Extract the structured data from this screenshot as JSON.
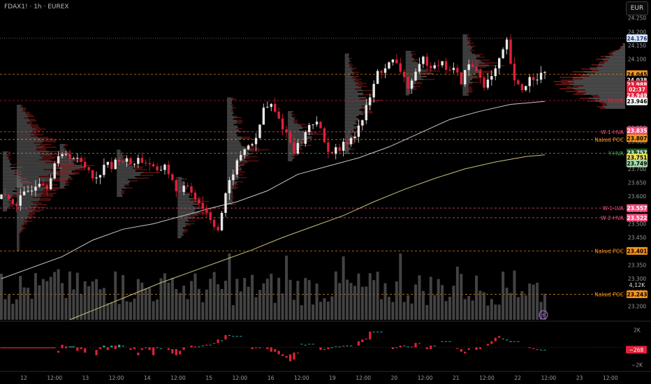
{
  "header": {
    "symbol_title": "FDAX1! · 1h · EUREX",
    "currency": "EUR"
  },
  "colors": {
    "background": "#000000",
    "up": "#e8e8e8",
    "down": "#e0213a",
    "ma_short": "#c8c8c8",
    "ma_long": "#c8c07a",
    "profile": "#8a8a8a",
    "profile_red": "#8b1a1a",
    "volume": "#5a5a5a",
    "axis_text": "#9a9a9a"
  },
  "chart_data": [
    {
      "type": "candlestick",
      "title": "FDAX1! · 1h · EUREX",
      "ylim": [
        23150,
        24290
      ],
      "y_ticks": [
        24250,
        24200,
        24150,
        24100,
        24050,
        24000,
        23950,
        23850,
        23800,
        23750,
        23700,
        23650,
        23600,
        23550,
        23500,
        23450,
        23400,
        23350,
        23300,
        23250,
        23200
      ],
      "x_ticks": [
        "12",
        "12:00",
        "13",
        "12:00",
        "14",
        "12:00",
        "15",
        "12:00",
        "16",
        "12:00",
        "19",
        "12:00",
        "20",
        "12:00",
        "21",
        "12:00",
        "22",
        "12:00",
        "23",
        "12:00"
      ],
      "price_axis_labels": [
        {
          "text": "24.176",
          "value": 24176,
          "bg": "#dde8f8",
          "fg": "#1a3a7a"
        },
        {
          "text": "24.045",
          "value": 24045,
          "bg": "#f7931a",
          "fg": "#000000"
        },
        {
          "text": "24.038",
          "value": 24024,
          "bg": "#000000",
          "fg": "#ffffff"
        },
        {
          "text": "23.988",
          "value": 24008,
          "bg": "#e0213a",
          "fg": "#ffffff"
        },
        {
          "text": "02:37",
          "value": 23990,
          "bg": "#e0213a",
          "fg": "#ffffff"
        },
        {
          "text": "23.949",
          "value": 23968,
          "bg": "#e0213a",
          "fg": "#ffffff"
        },
        {
          "text": "23.946",
          "value": 23946,
          "bg": "#ffffff",
          "fg": "#000000"
        },
        {
          "text": "23.835",
          "value": 23840,
          "bg": "#f04e7c",
          "fg": "#ffffff"
        },
        {
          "text": "23.807",
          "value": 23812,
          "bg": "#f7931a",
          "fg": "#000000"
        },
        {
          "text": "23.757",
          "value": 23760,
          "bg": "#1b5e20",
          "fg": "#ffffff"
        },
        {
          "text": "23.751",
          "value": 23741,
          "bg": "#f0e35a",
          "fg": "#000000"
        },
        {
          "text": "23.749",
          "value": 23720,
          "bg": "#a5d6a7",
          "fg": "#000000"
        },
        {
          "text": "23.557",
          "value": 23557,
          "bg": "#f04e7c",
          "fg": "#ffffff"
        },
        {
          "text": "23.522",
          "value": 23522,
          "bg": "#f04e7c",
          "fg": "#ffffff"
        },
        {
          "text": "23.401",
          "value": 23401,
          "bg": "#f7931a",
          "fg": "#000000"
        },
        {
          "text": "23.243",
          "value": 23243,
          "bg": "#f7931a",
          "fg": "#000000"
        }
      ],
      "levels": [
        {
          "label": "",
          "value": 24176,
          "color": "#7a7a7a",
          "style": "dotted"
        },
        {
          "label": "",
          "value": 24045,
          "color": "#f7931a",
          "style": "dashed"
        },
        {
          "label": "W-LVA",
          "value": 23949,
          "color": "#e0213a",
          "style": "dashed"
        },
        {
          "label": "W-1-HVA",
          "value": 23835,
          "color": "#f04e7c",
          "style": "dashed"
        },
        {
          "label": "Naked POC",
          "value": 23807,
          "color": "#f7931a",
          "style": "dashed"
        },
        {
          "label": "Y-HVA",
          "value": 23757,
          "color": "#4caf50",
          "style": "dashed"
        },
        {
          "label": "W-1-LVA",
          "value": 23557,
          "color": "#f04e7c",
          "style": "dashed"
        },
        {
          "label": "W-2-HVA",
          "value": 23522,
          "color": "#f04e7c",
          "style": "dashed"
        },
        {
          "label": "Naked POC",
          "value": 23401,
          "color": "#f7931a",
          "style": "dashed"
        },
        {
          "label": "Naked POC",
          "value": 23243,
          "color": "#f7931a",
          "style": "dashed"
        }
      ],
      "volume_label": "4,12K",
      "close_path": [
        [
          0,
          23600
        ],
        [
          4,
          23575
        ],
        [
          7,
          23620
        ],
        [
          10,
          23660
        ],
        [
          12,
          23640
        ],
        [
          14,
          23720
        ],
        [
          17,
          23760
        ],
        [
          19,
          23740
        ],
        [
          20,
          23730
        ],
        [
          23,
          23700
        ],
        [
          25,
          23660
        ],
        [
          27,
          23720
        ],
        [
          29,
          23705
        ],
        [
          31,
          23740
        ],
        [
          34,
          23720
        ],
        [
          36,
          23735
        ],
        [
          39,
          23720
        ],
        [
          41,
          23680
        ],
        [
          43,
          23720
        ],
        [
          45,
          23650
        ],
        [
          47,
          23610
        ],
        [
          49,
          23640
        ],
        [
          51,
          23600
        ],
        [
          53,
          23560
        ],
        [
          55,
          23520
        ],
        [
          57,
          23480
        ],
        [
          59,
          23600
        ],
        [
          61,
          23690
        ],
        [
          63,
          23750
        ],
        [
          65,
          23790
        ],
        [
          67,
          23800
        ],
        [
          69,
          23920
        ],
        [
          71,
          23930
        ],
        [
          73,
          23880
        ],
        [
          75,
          23830
        ],
        [
          77,
          23770
        ],
        [
          79,
          23800
        ],
        [
          81,
          23860
        ],
        [
          83,
          23880
        ],
        [
          85,
          23790
        ],
        [
          87,
          23760
        ],
        [
          89,
          23770
        ],
        [
          91,
          23800
        ],
        [
          93,
          23830
        ],
        [
          95,
          23880
        ],
        [
          97,
          23960
        ],
        [
          99,
          24050
        ],
        [
          101,
          24070
        ],
        [
          103,
          24090
        ],
        [
          105,
          24060
        ],
        [
          107,
          24000
        ],
        [
          109,
          24040
        ],
        [
          111,
          24100
        ],
        [
          113,
          24080
        ],
        [
          115,
          24090
        ],
        [
          117,
          24070
        ],
        [
          119,
          24060
        ],
        [
          121,
          24020
        ],
        [
          123,
          24080
        ],
        [
          125,
          24060
        ],
        [
          127,
          24010
        ],
        [
          129,
          24030
        ],
        [
          131,
          24090
        ],
        [
          133,
          24160
        ],
        [
          135,
          24010
        ],
        [
          137,
          23990
        ],
        [
          139,
          24030
        ],
        [
          141,
          24040
        ],
        [
          143,
          24045
        ]
      ],
      "ma_short_path": [
        [
          0,
          23300
        ],
        [
          8,
          23340
        ],
        [
          16,
          23380
        ],
        [
          24,
          23440
        ],
        [
          32,
          23480
        ],
        [
          40,
          23500
        ],
        [
          48,
          23530
        ],
        [
          56,
          23560
        ],
        [
          62,
          23580
        ],
        [
          70,
          23620
        ],
        [
          78,
          23680
        ],
        [
          86,
          23710
        ],
        [
          94,
          23740
        ],
        [
          102,
          23780
        ],
        [
          110,
          23830
        ],
        [
          118,
          23880
        ],
        [
          126,
          23910
        ],
        [
          134,
          23935
        ],
        [
          143,
          23946
        ]
      ],
      "ma_long_path": [
        [
          18,
          23150
        ],
        [
          26,
          23195
        ],
        [
          34,
          23240
        ],
        [
          42,
          23285
        ],
        [
          50,
          23325
        ],
        [
          58,
          23365
        ],
        [
          66,
          23405
        ],
        [
          74,
          23450
        ],
        [
          82,
          23490
        ],
        [
          90,
          23530
        ],
        [
          98,
          23580
        ],
        [
          106,
          23625
        ],
        [
          114,
          23665
        ],
        [
          122,
          23700
        ],
        [
          130,
          23725
        ],
        [
          138,
          23745
        ],
        [
          143,
          23751
        ]
      ],
      "candle_count": 144
    },
    {
      "type": "bar",
      "title": "",
      "ylim": [
        -2600,
        2600
      ],
      "y_ticks": [
        "2K",
        "−2K"
      ],
      "last_value_label": "−268",
      "segments": [
        [
          0,
          0,
          14,
          -100
        ],
        [
          15,
          -400,
          15,
          -600
        ],
        [
          16,
          300,
          16,
          -100
        ],
        [
          17,
          100,
          17,
          -100
        ],
        [
          18,
          0,
          19,
          100
        ],
        [
          20,
          0,
          20,
          -400
        ],
        [
          21,
          0,
          21,
          -200
        ],
        [
          22,
          -100,
          22,
          -600
        ],
        [
          25,
          -300,
          25,
          -900
        ],
        [
          26,
          0,
          26,
          -200
        ],
        [
          27,
          0,
          27,
          200
        ],
        [
          28,
          0,
          28,
          -300
        ],
        [
          29,
          0,
          29,
          200
        ],
        [
          30,
          200,
          30,
          -200
        ],
        [
          31,
          0,
          31,
          300
        ],
        [
          32,
          100,
          32,
          200
        ],
        [
          34,
          -100,
          34,
          -300
        ],
        [
          35,
          0,
          35,
          -200
        ],
        [
          36,
          -600,
          36,
          -900
        ],
        [
          37,
          -100,
          37,
          -300
        ],
        [
          38,
          0,
          38,
          -100
        ],
        [
          39,
          0,
          39,
          -300
        ],
        [
          40,
          0,
          40,
          -900
        ],
        [
          41,
          0,
          41,
          0
        ],
        [
          42,
          -100,
          42,
          -100
        ],
        [
          44,
          -100,
          44,
          -300
        ],
        [
          45,
          -200,
          45,
          -700
        ],
        [
          46,
          -200,
          46,
          -900
        ],
        [
          47,
          -400,
          47,
          -800
        ],
        [
          48,
          0,
          48,
          -300
        ],
        [
          50,
          200,
          50,
          0
        ],
        [
          51,
          100,
          51,
          0
        ],
        [
          52,
          100,
          52,
          100
        ],
        [
          53,
          200,
          53,
          200
        ],
        [
          54,
          300,
          54,
          200
        ],
        [
          55,
          300,
          55,
          300
        ],
        [
          56,
          500,
          56,
          400
        ],
        [
          57,
          900,
          57,
          500
        ],
        [
          58,
          800,
          58,
          800
        ],
        [
          59,
          1400,
          59,
          900
        ],
        [
          60,
          1400,
          60,
          1400
        ],
        [
          61,
          1300,
          61,
          1300
        ],
        [
          62,
          1300,
          62,
          1300
        ],
        [
          63,
          1300,
          63,
          1300
        ],
        [
          66,
          0,
          66,
          -200
        ],
        [
          67,
          0,
          67,
          -100
        ],
        [
          68,
          0,
          68,
          -100
        ],
        [
          70,
          0,
          70,
          -200
        ],
        [
          71,
          0,
          71,
          -500
        ],
        [
          72,
          -200,
          72,
          -500
        ],
        [
          73,
          -400,
          73,
          -800
        ],
        [
          74,
          -800,
          74,
          -1000
        ],
        [
          75,
          -1000,
          75,
          -1200
        ],
        [
          76,
          -800,
          76,
          -1600
        ],
        [
          77,
          -600,
          77,
          -1400
        ],
        [
          78,
          -600,
          78,
          -700
        ],
        [
          79,
          400,
          79,
          400
        ],
        [
          80,
          300,
          80,
          300
        ],
        [
          81,
          400,
          81,
          400
        ],
        [
          82,
          400,
          82,
          400
        ],
        [
          84,
          0,
          84,
          -300
        ],
        [
          85,
          -200,
          85,
          -300
        ],
        [
          86,
          0,
          86,
          -200
        ],
        [
          87,
          0,
          87,
          0
        ],
        [
          88,
          100,
          88,
          100
        ],
        [
          89,
          100,
          89,
          100
        ],
        [
          90,
          200,
          90,
          100
        ],
        [
          91,
          200,
          91,
          200
        ],
        [
          92,
          200,
          92,
          200
        ],
        [
          94,
          700,
          94,
          200
        ],
        [
          95,
          900,
          95,
          600
        ],
        [
          96,
          1000,
          96,
          900
        ],
        [
          97,
          1800,
          97,
          900
        ],
        [
          98,
          1800,
          98,
          1800
        ],
        [
          99,
          1800,
          99,
          1800
        ],
        [
          100,
          1800,
          100,
          1800
        ],
        [
          103,
          0,
          103,
          -200
        ],
        [
          104,
          0,
          104,
          -100
        ],
        [
          105,
          200,
          105,
          0
        ],
        [
          106,
          200,
          106,
          200
        ],
        [
          107,
          100,
          107,
          100
        ],
        [
          108,
          100,
          108,
          0
        ],
        [
          109,
          500,
          109,
          0
        ],
        [
          110,
          500,
          110,
          400
        ],
        [
          112,
          0,
          112,
          -200
        ],
        [
          113,
          200,
          113,
          -200
        ],
        [
          114,
          200,
          114,
          200
        ],
        [
          116,
          700,
          116,
          700
        ],
        [
          117,
          700,
          117,
          700
        ],
        [
          118,
          700,
          118,
          700
        ],
        [
          120,
          -100,
          120,
          -200
        ],
        [
          121,
          -200,
          121,
          -500
        ],
        [
          122,
          -500,
          122,
          -700
        ],
        [
          123,
          -100,
          123,
          -300
        ],
        [
          125,
          0,
          125,
          -300
        ],
        [
          126,
          0,
          126,
          -200
        ],
        [
          128,
          400,
          128,
          200
        ],
        [
          129,
          700,
          129,
          400
        ],
        [
          130,
          1100,
          130,
          700
        ],
        [
          131,
          1300,
          131,
          1100
        ],
        [
          132,
          1000,
          132,
          1000
        ],
        [
          133,
          800,
          133,
          900
        ],
        [
          134,
          600,
          134,
          700
        ],
        [
          135,
          700,
          135,
          600
        ],
        [
          136,
          700,
          136,
          700
        ],
        [
          139,
          0,
          139,
          -100
        ],
        [
          140,
          -100,
          140,
          -200
        ],
        [
          141,
          -200,
          141,
          -300
        ],
        [
          142,
          -300,
          142,
          -268
        ],
        [
          143,
          -268,
          143,
          -268
        ]
      ]
    }
  ]
}
